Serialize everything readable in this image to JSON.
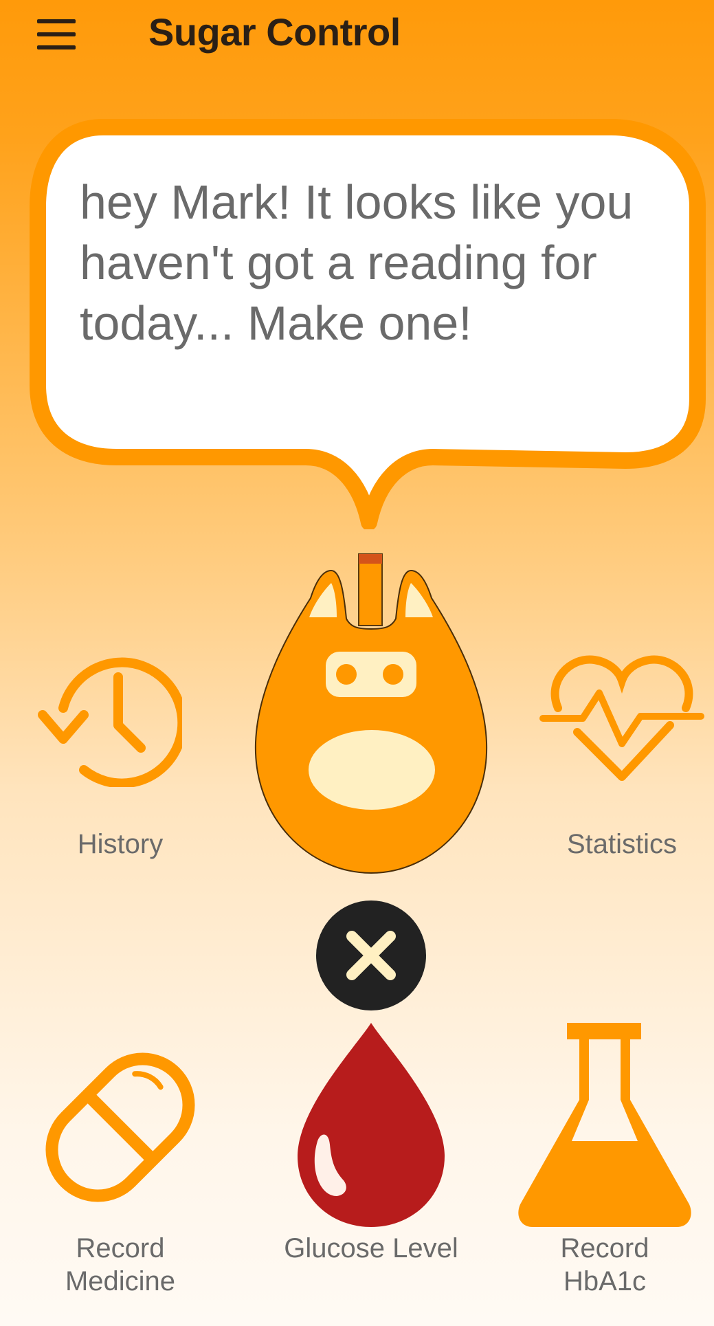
{
  "appbar": {
    "title": "Sugar Control",
    "menu_icon": "hamburger-menu-icon"
  },
  "bubble": {
    "message": "hey Mark! It looks like you haven't got a reading for today... Make one!"
  },
  "mascot": {
    "icon": "glucometer-mascot-icon"
  },
  "menu": {
    "history": {
      "label": "History",
      "icon": "history-clock-icon"
    },
    "statistics": {
      "label": "Statistics",
      "icon": "heart-pulse-icon"
    },
    "close": {
      "icon": "close-icon"
    },
    "record_medicine": {
      "label_line1": "Record",
      "label_line2": "Medicine",
      "icon": "pill-capsule-icon"
    },
    "glucose_level": {
      "label": "Glucose Level",
      "icon": "blood-drop-icon"
    },
    "record_hba1c": {
      "label_line1": "Record",
      "label_line2": "HbA1c",
      "icon": "lab-flask-icon"
    }
  },
  "colors": {
    "accent": "#ff9800",
    "title_text": "#2a1f16",
    "label_text": "#6a6a6a",
    "blood_red": "#b71c1c",
    "cream": "#fff0c2",
    "close_bg": "#222222"
  }
}
